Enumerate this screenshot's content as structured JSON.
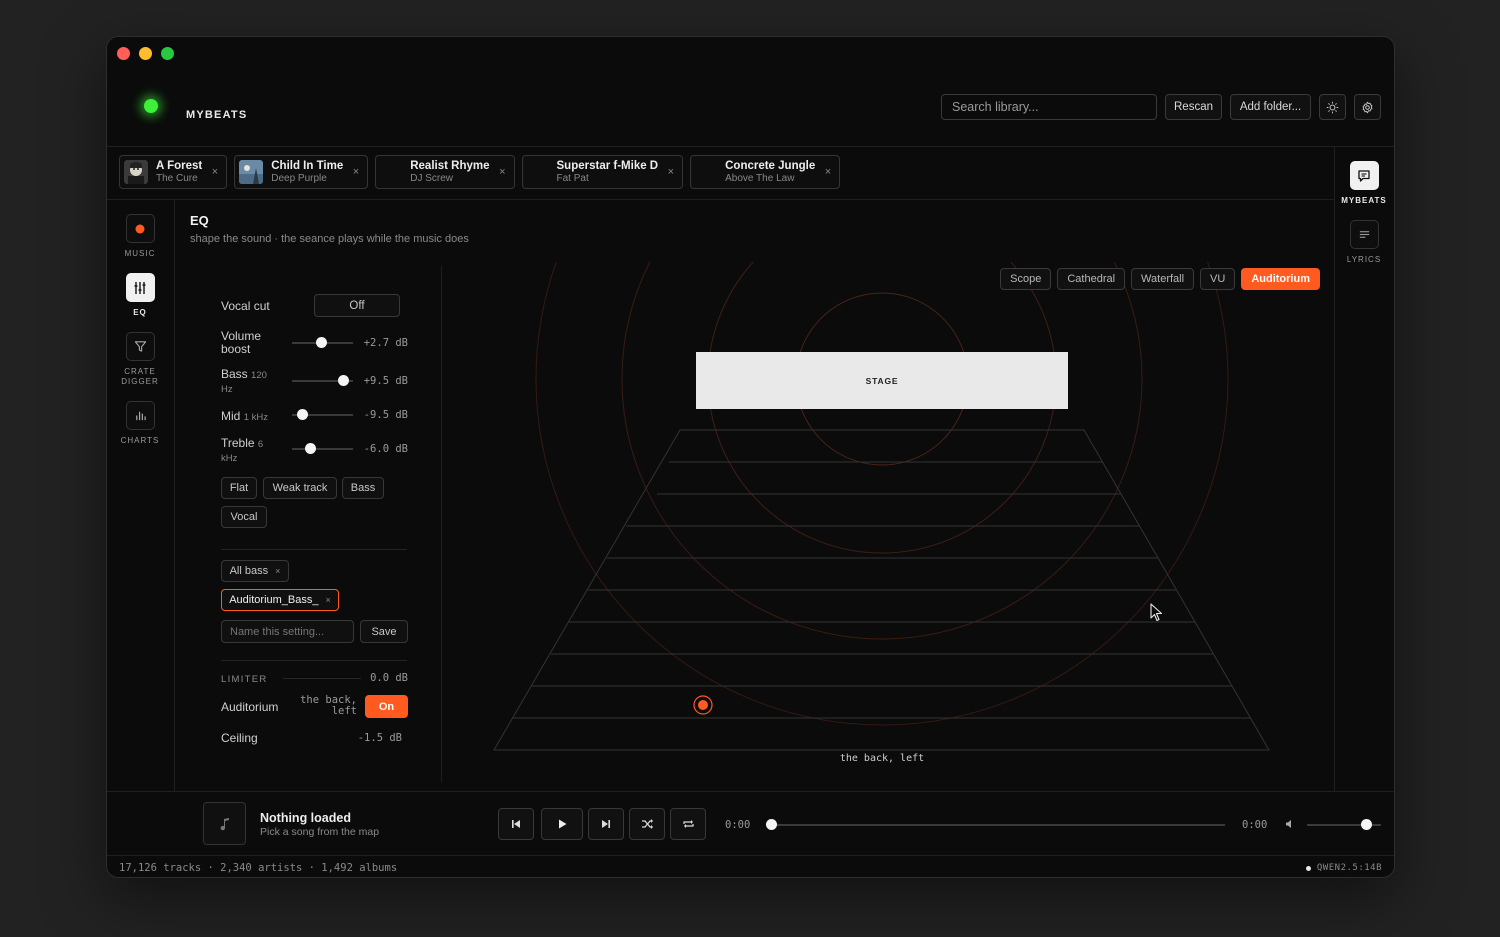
{
  "app": {
    "brand": "MYBEATS",
    "search_placeholder": "Search library...",
    "rescan_label": "Rescan",
    "add_folder_label": "Add folder..."
  },
  "tabs": [
    {
      "title": "A Forest",
      "artist": "The Cure",
      "has_art": true
    },
    {
      "title": "Child In Time",
      "artist": "Deep Purple",
      "has_art": true
    },
    {
      "title": "Realist Rhyme",
      "artist": "DJ Screw",
      "has_art": false
    },
    {
      "title": "Superstar f-Mike D",
      "artist": "Fat Pat",
      "has_art": false
    },
    {
      "title": "Concrete Jungle",
      "artist": "Above The Law",
      "has_art": false
    }
  ],
  "tab_close_glyph": "×",
  "leftnav": [
    {
      "label": "MUSIC",
      "icon": "record-dot-icon",
      "active": false
    },
    {
      "label": "EQ",
      "icon": "sliders-icon",
      "active": true
    },
    {
      "label": "CRATE DIGGER",
      "icon": "filter-icon",
      "active": false
    },
    {
      "label": "CHARTS",
      "icon": "bar-chart-icon",
      "active": false
    }
  ],
  "rightnav": [
    {
      "label": "MYBEATS",
      "icon": "chat-icon",
      "active": true
    },
    {
      "label": "LYRICS",
      "icon": "lyrics-icon",
      "active": false
    }
  ],
  "eq": {
    "title": "EQ",
    "subtitle": "shape the sound · the seance plays while the music does",
    "vocal_cut": {
      "label": "Vocal cut",
      "value": "Off"
    },
    "volume_boost": {
      "label": "Volume",
      "label2": "boost",
      "value": "+2.7 dB",
      "level": 0.47
    },
    "bass": {
      "label": "Bass",
      "freq": "120",
      "freq_unit": "Hz",
      "value": "+9.5 dB",
      "level": 0.83
    },
    "mid": {
      "label": "Mid",
      "freq": "1 kHz",
      "value": "-9.5 dB",
      "level": 0.17
    },
    "treble": {
      "label": "Treble",
      "freq": "6",
      "freq_unit": "kHz",
      "value": "-6.0 dB",
      "level": 0.3
    },
    "presets": [
      "Flat",
      "Weak track",
      "Bass",
      "Vocal"
    ],
    "saved": [
      {
        "name": "All bass",
        "active": false
      },
      {
        "name": "Auditorium_Bass_",
        "active": true
      }
    ],
    "name_placeholder": "Name this setting...",
    "save_label": "Save",
    "limiter": {
      "label": "LIMITER",
      "value": "0.0 dB"
    },
    "auditorium": {
      "label": "Auditorium",
      "position": "the back, left",
      "position_line1": "the back,",
      "position_line2": "left",
      "toggle": "On"
    },
    "ceiling": {
      "label": "Ceiling",
      "value": "-1.5 dB"
    }
  },
  "visualizer": {
    "modes": [
      "Scope",
      "Cathedral",
      "Waterfall",
      "VU",
      "Auditorium"
    ],
    "active_mode": "Auditorium",
    "stage_label": "STAGE",
    "listener_label": "the back, left",
    "accent": "#ff5a1f"
  },
  "player": {
    "title": "Nothing loaded",
    "subtitle": "Pick a song from the map",
    "elapsed": "0:00",
    "duration": "0:00",
    "progress": 0,
    "volume": 0.8
  },
  "status": {
    "left": "17,126 tracks · 2,340 artists · 1,492 albums",
    "right": "QWEN2.5:14B"
  }
}
